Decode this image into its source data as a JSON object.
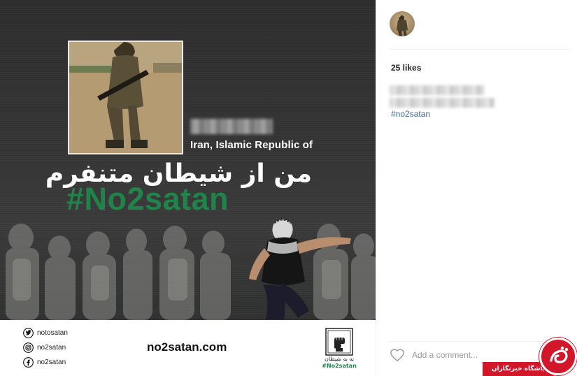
{
  "post": {
    "country": "Iran, Islamic Republic of",
    "persian_slogan": "من از شیطان متنفرم",
    "hashtag": "#No2satan",
    "website": "no2satan.com",
    "logo_persian": "نه به شیطان",
    "logo_hashtag": "#No2satan",
    "social": [
      {
        "icon": "twitter-icon",
        "handle": "notosatan"
      },
      {
        "icon": "instagram-icon",
        "handle": "no2satan"
      },
      {
        "icon": "facebook-icon",
        "handle": "no2satan"
      }
    ]
  },
  "panel": {
    "likes": "25 likes",
    "caption_hashtag": "#no2satan",
    "comment_placeholder": "Add a comment..."
  },
  "watermark": {
    "label": "باشگاه خبرنگاران"
  },
  "colors": {
    "hashtag_green": "#1e8a4c",
    "link_blue": "#3e6996",
    "watermark_red": "#d2172a"
  }
}
